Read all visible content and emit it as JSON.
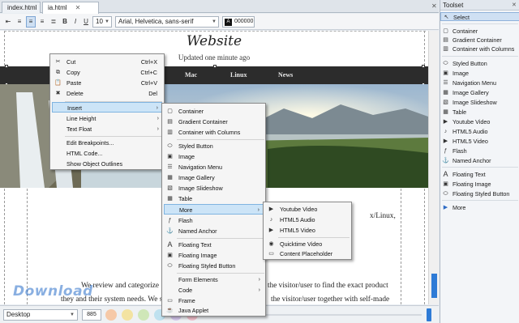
{
  "tabs": [
    {
      "label": "index.html"
    },
    {
      "label": "ia.html"
    }
  ],
  "format_toolbar": {
    "font_size": "10",
    "font_family": "Arial, Helvetica, sans-serif",
    "color_swatch_label": "A",
    "color_value": "000000",
    "bold": "B",
    "italic": "I",
    "underline": "U"
  },
  "page": {
    "title": "Website",
    "subtitle": "Updated one minute ago",
    "nav": [
      "Mac",
      "Linux",
      "News"
    ],
    "body_lines": [
      "We review and categorize",
      "the visitor/user to find the exact product",
      "they and their system needs. We strive to",
      "the visitor/user together with self-made"
    ],
    "right_fragment": "x/Linux,"
  },
  "status": {
    "view": "Desktop",
    "width": "885"
  },
  "watermark": "Download",
  "colors": {
    "accent": "#cfe0f3",
    "nav_bg": "#2c2c2c",
    "menu_highlight": "#cce4f7"
  },
  "toolset": {
    "title": "Toolset",
    "items": [
      {
        "label": "Select",
        "icon": "pointer-icon"
      },
      {
        "label": "Container",
        "icon": "container-icon"
      },
      {
        "label": "Gradient Container",
        "icon": "gradient-container-icon"
      },
      {
        "label": "Container with Columns",
        "icon": "columns-icon"
      },
      {
        "label": "Styled Button",
        "icon": "button-icon"
      },
      {
        "label": "Image",
        "icon": "image-icon"
      },
      {
        "label": "Navigation Menu",
        "icon": "nav-menu-icon"
      },
      {
        "label": "Image Gallery",
        "icon": "gallery-icon"
      },
      {
        "label": "Image Slideshow",
        "icon": "slideshow-icon"
      },
      {
        "label": "Table",
        "icon": "table-icon"
      },
      {
        "label": "Youtube Video",
        "icon": "youtube-icon"
      },
      {
        "label": "HTML5 Audio",
        "icon": "audio-icon"
      },
      {
        "label": "HTML5 Video",
        "icon": "video-icon"
      },
      {
        "label": "Flash",
        "icon": "flash-icon"
      },
      {
        "label": "Named Anchor",
        "icon": "anchor-icon"
      },
      {
        "label": "Floating Text",
        "icon": "text-icon"
      },
      {
        "label": "Floating Image",
        "icon": "float-image-icon"
      },
      {
        "label": "Floating Styled Button",
        "icon": "float-button-icon"
      },
      {
        "label": "More",
        "icon": "more-arrow-icon"
      }
    ]
  },
  "context_menu": {
    "items": [
      {
        "label": "Cut",
        "shortcut": "Ctrl+X",
        "icon": "cut-icon"
      },
      {
        "label": "Copy",
        "shortcut": "Ctrl+C",
        "icon": "copy-icon"
      },
      {
        "label": "Paste",
        "shortcut": "Ctrl+V",
        "icon": "paste-icon"
      },
      {
        "label": "Delete",
        "shortcut": "Del",
        "icon": "delete-icon"
      },
      {
        "label": "Insert"
      },
      {
        "label": "Line Height"
      },
      {
        "label": "Text Float"
      },
      {
        "label": "Edit Breakpoints..."
      },
      {
        "label": "HTML Code..."
      },
      {
        "label": "Show Object Outlines"
      }
    ]
  },
  "insert_menu": {
    "items": [
      {
        "label": "Container",
        "icon": "container-icon"
      },
      {
        "label": "Gradient Container",
        "icon": "gradient-container-icon"
      },
      {
        "label": "Container with Columns",
        "icon": "columns-icon"
      },
      {
        "label": "Styled Button",
        "icon": "button-icon"
      },
      {
        "label": "Image",
        "icon": "image-icon"
      },
      {
        "label": "Navigation Menu",
        "icon": "nav-menu-icon"
      },
      {
        "label": "Image Gallery",
        "icon": "gallery-icon"
      },
      {
        "label": "Image Slideshow",
        "icon": "slideshow-icon"
      },
      {
        "label": "Table",
        "icon": "table-icon"
      },
      {
        "label": "More"
      },
      {
        "label": "Flash",
        "icon": "flash-icon"
      },
      {
        "label": "Named Anchor",
        "icon": "anchor-icon"
      },
      {
        "label": "Floating Text",
        "icon": "text-icon"
      },
      {
        "label": "Floating Image",
        "icon": "float-image-icon"
      },
      {
        "label": "Floating Styled Button",
        "icon": "float-button-icon"
      },
      {
        "label": "Form Elements"
      },
      {
        "label": "Code"
      },
      {
        "label": "Frame",
        "icon": "frame-icon"
      },
      {
        "label": "Java Applet",
        "icon": "java-icon"
      }
    ]
  },
  "more_menu": {
    "items": [
      {
        "label": "Youtube Video",
        "icon": "youtube-icon"
      },
      {
        "label": "HTML5 Audio",
        "icon": "audio-icon"
      },
      {
        "label": "HTML5 Video",
        "icon": "video-icon"
      },
      {
        "label": "Quicktime Video",
        "icon": "quicktime-icon"
      },
      {
        "label": "Content Placeholder",
        "icon": "placeholder-icon"
      }
    ]
  }
}
